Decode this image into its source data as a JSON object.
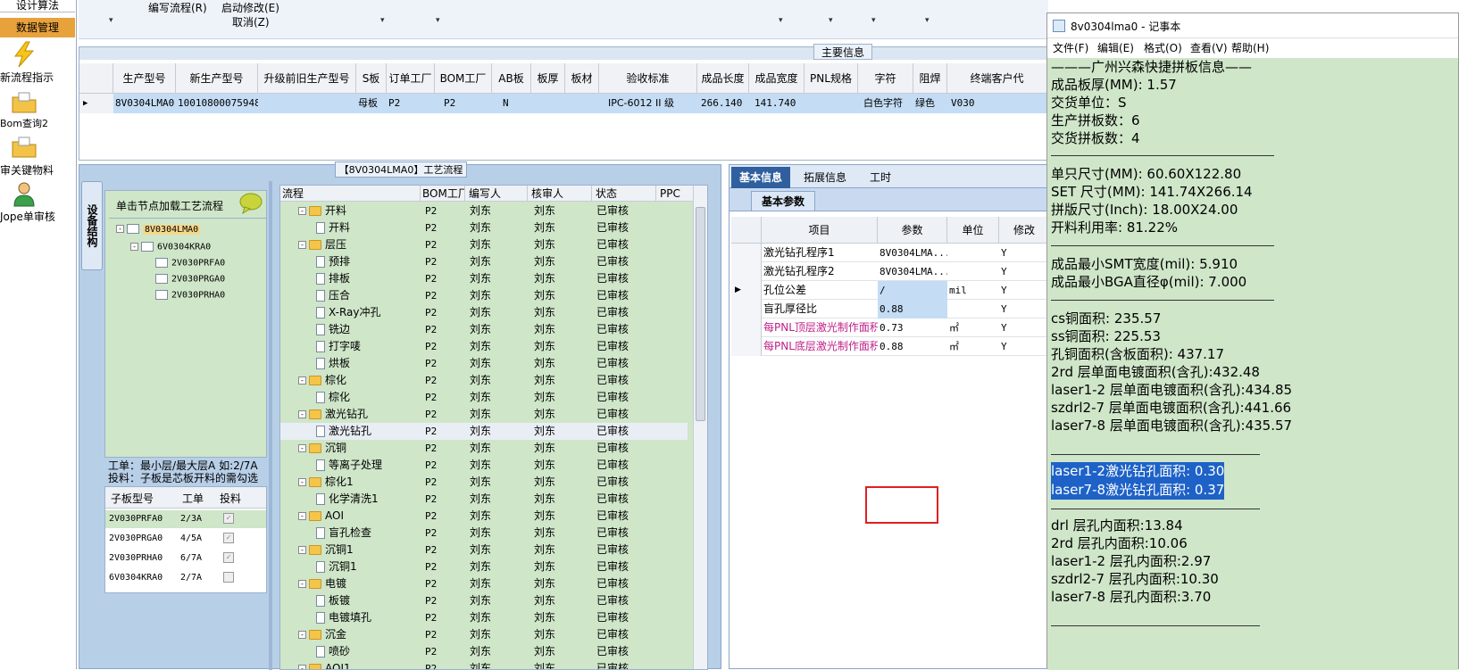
{
  "left_nav": {
    "items": [
      {
        "label": "设计算法",
        "icon": ""
      },
      {
        "label": "数据管理",
        "icon": ""
      },
      {
        "label": "新流程指示",
        "icon": "lightning-icon"
      },
      {
        "label": "Bom查询2",
        "icon": "folder-icon"
      },
      {
        "label": "审关键物料",
        "icon": "folder-icon"
      },
      {
        "label": "Jope单审核",
        "icon": "user-icon"
      }
    ]
  },
  "top_menu": {
    "edit_flow": "编写流程(R)",
    "start_modify": "启动修改(E)",
    "cancel": "取消(Z)"
  },
  "master": {
    "title": "主要信息",
    "columns": [
      "生产型号",
      "新生产型号",
      "升级前旧生产型号",
      "S板",
      "订单工厂",
      "BOM工厂",
      "AB板",
      "板厚",
      "板材",
      "验收标准",
      "成品长度",
      "成品宽度",
      "PNL规格",
      "字符",
      "阻焊",
      "终端客户代"
    ],
    "row": [
      "8V0304LMA0",
      "10010800075948",
      "",
      "母板",
      "P2",
      "P2",
      "N",
      "",
      "",
      "IPC-6012 II 级",
      "266.140",
      "141.740",
      "",
      "白色字符",
      "绿色",
      "V030"
    ]
  },
  "flow_panel": {
    "title": "【8V0304LMA0】工艺流程",
    "side_tab": "设备结构",
    "tree_header": "单击节点加载工艺流程",
    "tree": [
      "8V0304LMA0",
      "6V0304KRA0",
      "2V030PRFA0",
      "2V030PRGA0",
      "2V030PRHA0"
    ],
    "note_line1": "工单：最小层/最大层A 如:2/7A",
    "note_line2": "投料：子板是芯板开料的需勾选",
    "sub_headers": [
      "子板型号",
      "工单",
      "投料"
    ],
    "sub_rows": [
      {
        "model": "2V030PRFA0",
        "order": "2/3A",
        "checked": true
      },
      {
        "model": "2V030PRGA0",
        "order": "4/5A",
        "checked": true
      },
      {
        "model": "2V030PRHA0",
        "order": "6/7A",
        "checked": true
      },
      {
        "model": "6V0304KRA0",
        "order": "2/7A",
        "checked": false
      }
    ],
    "flow_headers": [
      "流程",
      "BOM工厂",
      "编写人",
      "核审人",
      "状态",
      "PPC"
    ],
    "flow_rows": [
      {
        "name": "开料",
        "level": 0,
        "bom": "P2",
        "writer": "刘东",
        "reviewer": "刘东",
        "status": "已审核"
      },
      {
        "name": "开料",
        "level": 1,
        "bom": "P2",
        "writer": "刘东",
        "reviewer": "刘东",
        "status": "已审核"
      },
      {
        "name": "层压",
        "level": 0,
        "bom": "P2",
        "writer": "刘东",
        "reviewer": "刘东",
        "status": "已审核"
      },
      {
        "name": "预排",
        "level": 1,
        "bom": "P2",
        "writer": "刘东",
        "reviewer": "刘东",
        "status": "已审核"
      },
      {
        "name": "排板",
        "level": 1,
        "bom": "P2",
        "writer": "刘东",
        "reviewer": "刘东",
        "status": "已审核"
      },
      {
        "name": "压合",
        "level": 1,
        "bom": "P2",
        "writer": "刘东",
        "reviewer": "刘东",
        "status": "已审核"
      },
      {
        "name": "X-Ray冲孔",
        "level": 1,
        "bom": "P2",
        "writer": "刘东",
        "reviewer": "刘东",
        "status": "已审核"
      },
      {
        "name": "铣边",
        "level": 1,
        "bom": "P2",
        "writer": "刘东",
        "reviewer": "刘东",
        "status": "已审核"
      },
      {
        "name": "打字唛",
        "level": 1,
        "bom": "P2",
        "writer": "刘东",
        "reviewer": "刘东",
        "status": "已审核"
      },
      {
        "name": "烘板",
        "level": 1,
        "bom": "P2",
        "writer": "刘东",
        "reviewer": "刘东",
        "status": "已审核"
      },
      {
        "name": "棕化",
        "level": 0,
        "bom": "P2",
        "writer": "刘东",
        "reviewer": "刘东",
        "status": "已审核"
      },
      {
        "name": "棕化",
        "level": 1,
        "bom": "P2",
        "writer": "刘东",
        "reviewer": "刘东",
        "status": "已审核"
      },
      {
        "name": "激光钻孔",
        "level": 0,
        "bom": "P2",
        "writer": "刘东",
        "reviewer": "刘东",
        "status": "已审核"
      },
      {
        "name": "激光钻孔",
        "level": 1,
        "bom": "P2",
        "writer": "刘东",
        "reviewer": "刘东",
        "status": "已审核"
      },
      {
        "name": "沉铜",
        "level": 0,
        "bom": "P2",
        "writer": "刘东",
        "reviewer": "刘东",
        "status": "已审核"
      },
      {
        "name": "等离子处理",
        "level": 1,
        "bom": "P2",
        "writer": "刘东",
        "reviewer": "刘东",
        "status": "已审核"
      },
      {
        "name": "棕化1",
        "level": 0,
        "bom": "P2",
        "writer": "刘东",
        "reviewer": "刘东",
        "status": "已审核"
      },
      {
        "name": "化学清洗1",
        "level": 1,
        "bom": "P2",
        "writer": "刘东",
        "reviewer": "刘东",
        "status": "已审核"
      },
      {
        "name": "AOI",
        "level": 0,
        "bom": "P2",
        "writer": "刘东",
        "reviewer": "刘东",
        "status": "已审核"
      },
      {
        "name": "盲孔检查",
        "level": 1,
        "bom": "P2",
        "writer": "刘东",
        "reviewer": "刘东",
        "status": "已审核"
      },
      {
        "name": "沉铜1",
        "level": 0,
        "bom": "P2",
        "writer": "刘东",
        "reviewer": "刘东",
        "status": "已审核"
      },
      {
        "name": "沉铜1",
        "level": 1,
        "bom": "P2",
        "writer": "刘东",
        "reviewer": "刘东",
        "status": "已审核"
      },
      {
        "name": "电镀",
        "level": 0,
        "bom": "P2",
        "writer": "刘东",
        "reviewer": "刘东",
        "status": "已审核"
      },
      {
        "name": "板镀",
        "level": 1,
        "bom": "P2",
        "writer": "刘东",
        "reviewer": "刘东",
        "status": "已审核"
      },
      {
        "name": "电镀填孔",
        "level": 1,
        "bom": "P2",
        "writer": "刘东",
        "reviewer": "刘东",
        "status": "已审核"
      },
      {
        "name": "沉金",
        "level": 0,
        "bom": "P2",
        "writer": "刘东",
        "reviewer": "刘东",
        "status": "已审核"
      },
      {
        "name": "喷砂",
        "level": 1,
        "bom": "P2",
        "writer": "刘东",
        "reviewer": "刘东",
        "status": "已审核"
      },
      {
        "name": "AOI1",
        "level": 0,
        "bom": "P2",
        "writer": "刘东",
        "reviewer": "刘东",
        "status": "已审核"
      }
    ]
  },
  "params_panel": {
    "tabs": [
      "基本信息",
      "拓展信息",
      "工时"
    ],
    "subtab": "基本参数",
    "headers": [
      "项目",
      "参数",
      "单位",
      "修改"
    ],
    "rows": [
      {
        "item": "激光钻孔程序1",
        "value": "8V0304LMA...",
        "unit": "",
        "mod": "Y"
      },
      {
        "item": "激光钻孔程序2",
        "value": "8V0304LMA...",
        "unit": "",
        "mod": "Y"
      },
      {
        "item": "孔位公差",
        "value": "/",
        "unit": "mil",
        "mod": "Y"
      },
      {
        "item": "盲孔厚径比",
        "value": "0.88",
        "unit": "",
        "mod": "Y"
      },
      {
        "item": "每PNL顶层激光制作面积",
        "value": "0.73",
        "unit": "㎡",
        "mod": "Y"
      },
      {
        "item": "每PNL底层激光制作面积",
        "value": "0.88",
        "unit": "㎡",
        "mod": "Y"
      }
    ]
  },
  "notepad": {
    "title": "8v0304lma0 - 记事本",
    "menu": [
      "文件(F)",
      "编辑(E)",
      "格式(O)",
      "查看(V)",
      "帮助(H)"
    ],
    "lines": {
      "l1": "———广州兴森快捷拼板信息——",
      "l2": "成品板厚(MM): 1.57",
      "l3": "交货单位：S",
      "l4": "生产拼板数：6",
      "l5": "交货拼板数：4",
      "l6": "单只尺寸(MM): 60.60X122.80",
      "l7": "SET 尺寸(MM): 141.74X266.14",
      "l8": "拼版尺寸(Inch): 18.00X24.00",
      "l9": "开料利用率: 81.22%",
      "l10": "成品最小SMT宽度(mil): 5.910",
      "l11": "成品最小BGA直径φ(mil):  7.000",
      "l12": "cs铜面积: 235.57",
      "l13": "ss铜面积: 225.53",
      "l14": "孔铜面积(含板面积): 437.17",
      "l15": "2rd         层单面电镀面积(含孔):432.48",
      "l16": "laser1-2      层单面电镀面积(含孔):434.85",
      "l17": "szdrl2-7      层单面电镀面积(含孔):441.66",
      "l18": "laser7-8      层单面电镀面积(含孔):435.57",
      "l19": "laser1-2激光钻孔面积: 0.30",
      "l20": "laser7-8激光钻孔面积: 0.37",
      "l21": "drl          层孔内面积:13.84",
      "l22": "2rd          层孔内面积:10.06",
      "l23": "laser1-2      层孔内面积:2.97",
      "l24": "szdrl2-7      层孔内面积:10.30",
      "l25": "laser7-8      层孔内面积:3.70"
    }
  },
  "colors": {
    "green_bg": "#cfe6c9",
    "blue_panel": "#b8cfe8",
    "header_blue": "#4a78b8",
    "selection": "#3a7bd5",
    "highlight_row": "#c9e0f7"
  }
}
